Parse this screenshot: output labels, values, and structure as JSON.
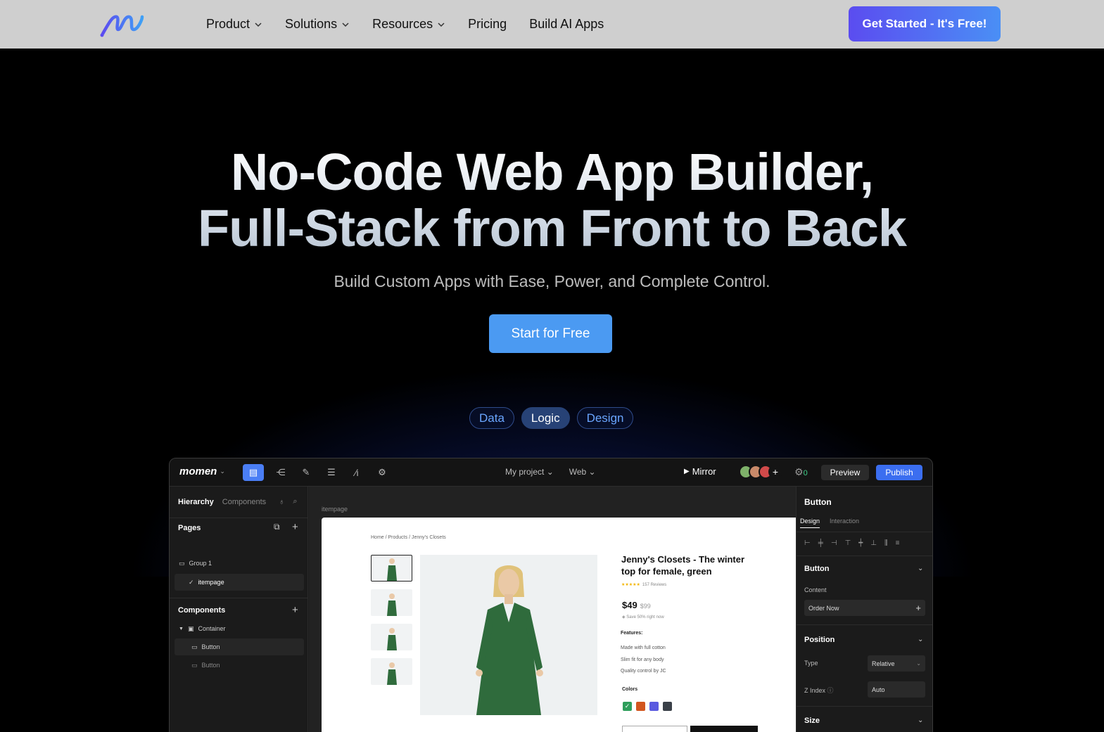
{
  "nav": {
    "links": [
      {
        "label": "Product",
        "has_menu": true
      },
      {
        "label": "Solutions",
        "has_menu": true
      },
      {
        "label": "Resources",
        "has_menu": true
      },
      {
        "label": "Pricing",
        "has_menu": false
      },
      {
        "label": "Build AI Apps",
        "has_menu": false
      }
    ],
    "cta": "Get Started - It's Free!"
  },
  "hero": {
    "title_line1": "No-Code Web App Builder,",
    "title_line2": "Full-Stack from Front to Back",
    "subtitle": "Build Custom Apps with Ease, Power, and Complete Control.",
    "cta": "Start for Free"
  },
  "pills": [
    {
      "label": "Data",
      "active": false
    },
    {
      "label": "Logic",
      "active": true
    },
    {
      "label": "Design",
      "active": false
    }
  ],
  "app": {
    "brand": "momen",
    "project": "My project",
    "platform": "Web",
    "mirror": "Mirror",
    "notification_count": "0",
    "preview": "Preview",
    "publish": "Publish",
    "left": {
      "tab_hierarchy": "Hierarchy",
      "tab_components": "Components",
      "pages_heading": "Pages",
      "group": "Group 1",
      "page": "itempage",
      "components_heading": "Components",
      "tree": [
        "Container",
        "Button",
        "Button"
      ]
    },
    "canvas": {
      "label": "itempage",
      "breadcrumb": "Home / Products / Jenny's Closets",
      "product_title": "Jenny's Closets - The winter top for female, green",
      "stars": "★★★★★",
      "reviews": "157 Reviews",
      "price": "$49",
      "old_price": "$99",
      "save": "Save 50% right now",
      "features_heading": "Features:",
      "features": [
        "Made with full cotton",
        "Slim fit for any body",
        "Quality control by JC"
      ],
      "colors_heading": "Colors",
      "colors": [
        "#2e9e5b",
        "#d2561f",
        "#5b5be0",
        "#3a4048"
      ]
    },
    "right": {
      "title": "Button",
      "tab_design": "Design",
      "tab_interaction": "Interaction",
      "button_section": "Button",
      "content_label": "Content",
      "content_value": "Order Now",
      "position_section": "Position",
      "type_label": "Type",
      "type_value": "Relative",
      "zindex_label": "Z Index",
      "zindex_value": "Auto",
      "size_section": "Size"
    }
  }
}
